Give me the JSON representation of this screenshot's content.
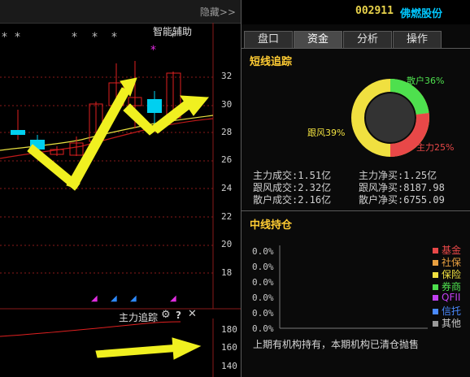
{
  "chart": {
    "hide_label": "隐藏>>",
    "indicator_label": "智能辅助",
    "yticks": [
      "32",
      "30",
      "28",
      "26",
      "24",
      "22",
      "20",
      "18"
    ],
    "sub_indicator_label": "主力追踪",
    "sub_yticks": [
      "180",
      "160",
      "140"
    ]
  },
  "header": {
    "stock_code": "002911",
    "stock_name": "佛燃股份"
  },
  "tabs": [
    "盘口",
    "资金",
    "分析",
    "操作"
  ],
  "active_tab": "资金",
  "short_track": {
    "title": "短线追踪",
    "donut": [
      {
        "label": "散户36%",
        "value": 36,
        "color": "#4ee04e"
      },
      {
        "label": "主力25%",
        "value": 25,
        "color": "#e84848"
      },
      {
        "label": "跟风39%",
        "value": 39,
        "color": "#f0e040"
      }
    ],
    "stats": [
      {
        "label": "主力成交:",
        "value": "1.51亿"
      },
      {
        "label": "主力净买:",
        "value": "1.25亿"
      },
      {
        "label": "跟风成交:",
        "value": "2.32亿"
      },
      {
        "label": "跟风净买:",
        "value": "8187.98"
      },
      {
        "label": "散户成交:",
        "value": "2.16亿"
      },
      {
        "label": "散户净买:",
        "value": "6755.09"
      }
    ]
  },
  "mid_hold": {
    "title": "中线持仓",
    "percent_labels": [
      "0.0%",
      "0.0%",
      "0.0%",
      "0.0%",
      "0.0%",
      "0.0%"
    ],
    "legend": [
      {
        "label": "基金",
        "color": "#e84848"
      },
      {
        "label": "社保",
        "color": "#e8a040"
      },
      {
        "label": "保险",
        "color": "#f0e040"
      },
      {
        "label": "券商",
        "color": "#4ee04e"
      },
      {
        "label": "QFII",
        "color": "#c040f0"
      },
      {
        "label": "信托",
        "color": "#4a8aff"
      },
      {
        "label": "其他",
        "color": "#9a9a9a"
      }
    ],
    "note": "上期有机构持有，本期机构已清仓抛售"
  }
}
